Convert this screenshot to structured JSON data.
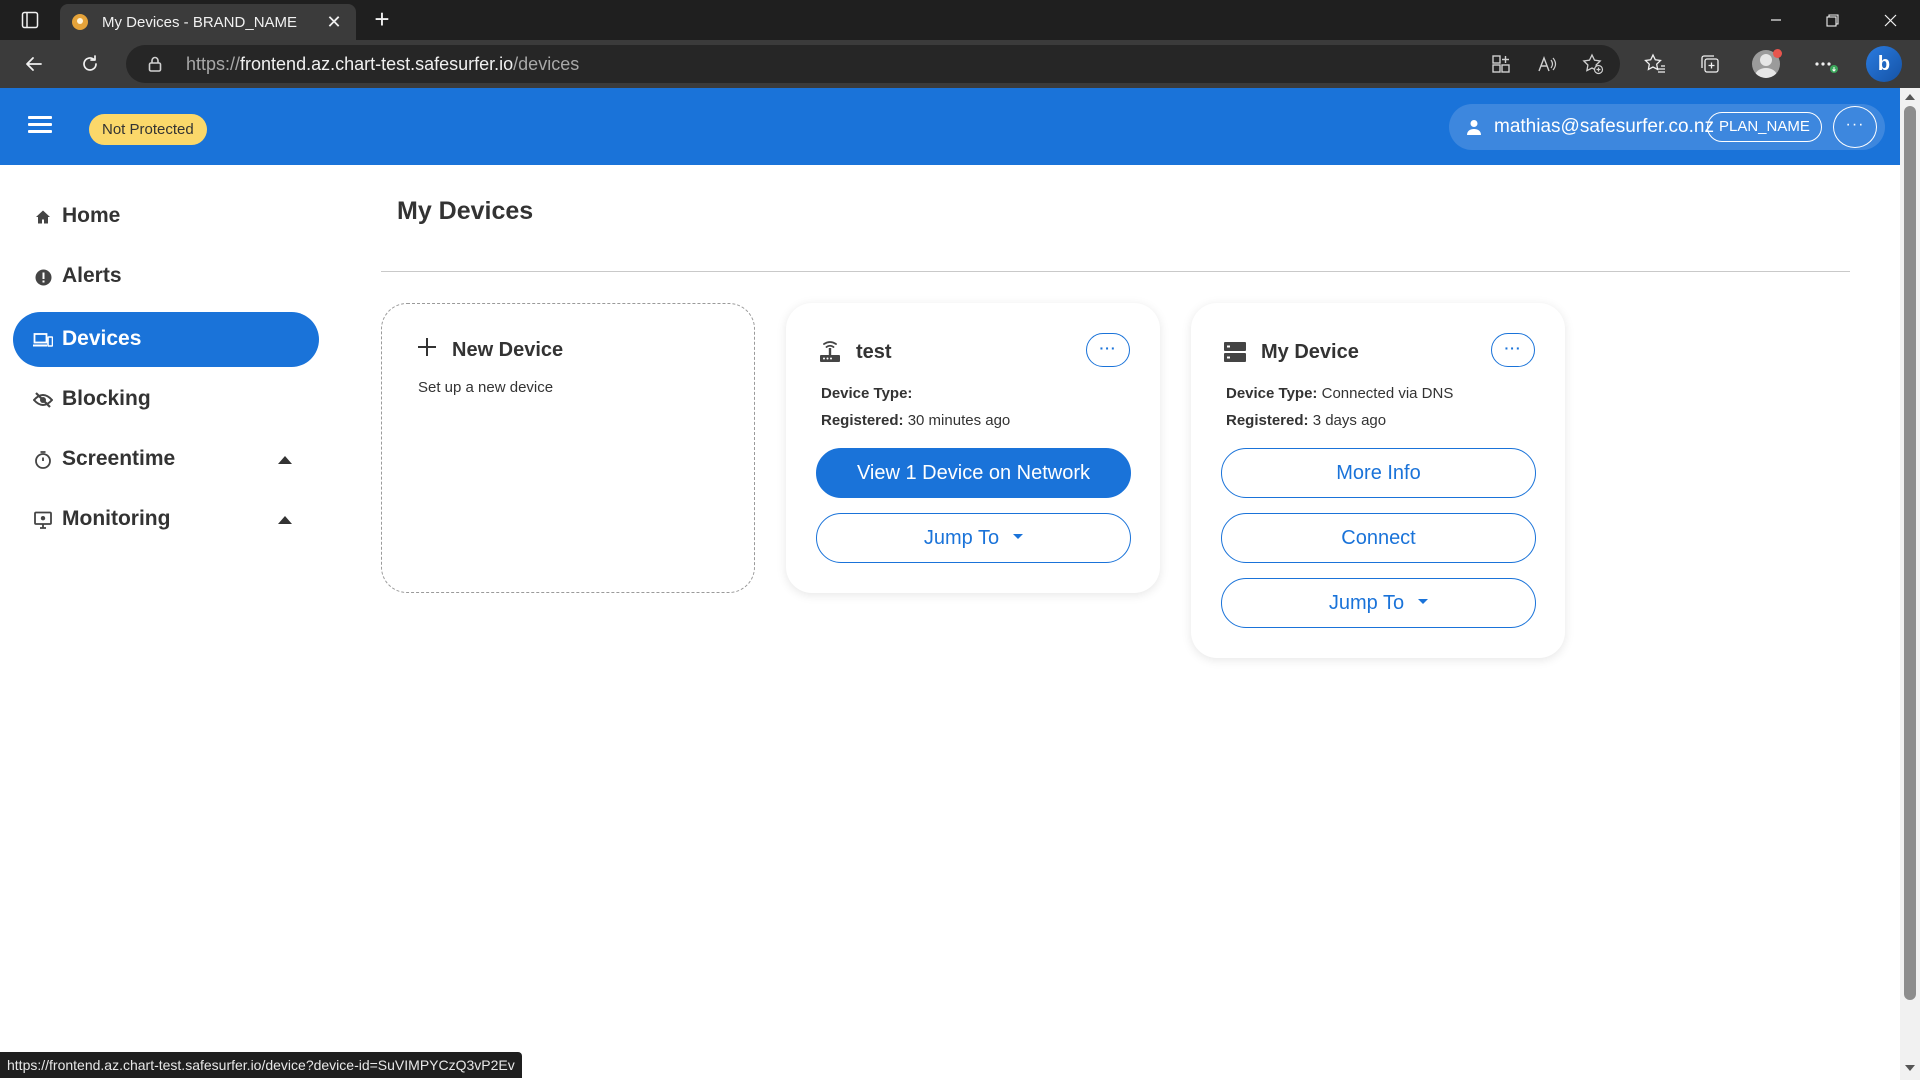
{
  "browser": {
    "tab_title": "My Devices - BRAND_NAME",
    "tab_close": "✕",
    "new_tab": "+",
    "address": {
      "scheme": "https://",
      "host": "frontend.az.chart-test.safesurfer.io",
      "path": "/devices"
    },
    "status_url": "https://frontend.az.chart-test.safesurfer.io/device?device-id=SuVIMPYCzQ3vP2Ev",
    "copilot_letter": "b"
  },
  "header": {
    "status_badge": "Not Protected",
    "email": "mathias@safesurfer.co.nz",
    "plan": "PLAN_NAME",
    "more": "···",
    "brand_color": "#1a73d9",
    "badge_color": "#fbd86a"
  },
  "sidebar": {
    "items": [
      {
        "label": "Home",
        "icon": "home-icon"
      },
      {
        "label": "Alerts",
        "icon": "alert-icon"
      },
      {
        "label": "Devices",
        "icon": "devices-icon",
        "active": true
      },
      {
        "label": "Blocking",
        "icon": "eye-off-icon"
      },
      {
        "label": "Screentime",
        "icon": "timer-icon",
        "expandable": true
      },
      {
        "label": "Monitoring",
        "icon": "monitor-icon",
        "expandable": true
      }
    ]
  },
  "main": {
    "title": "My Devices",
    "new_device": {
      "title": "New Device",
      "subtitle": "Set up a new device"
    },
    "devices": [
      {
        "name": "test",
        "icon": "router-icon",
        "type_label": "Device Type:",
        "type_value": "",
        "registered_label": "Registered:",
        "registered_value": "30 minutes ago",
        "more": "···",
        "buttons": {
          "view": "View 1 Device on Network",
          "jump": "Jump To"
        }
      },
      {
        "name": "My Device",
        "icon": "dns-server-icon",
        "type_label": "Device Type:",
        "type_value": "Connected via DNS",
        "registered_label": "Registered:",
        "registered_value": "3 days ago",
        "more": "···",
        "buttons": {
          "more_info": "More Info",
          "connect": "Connect",
          "jump": "Jump To"
        }
      }
    ]
  }
}
